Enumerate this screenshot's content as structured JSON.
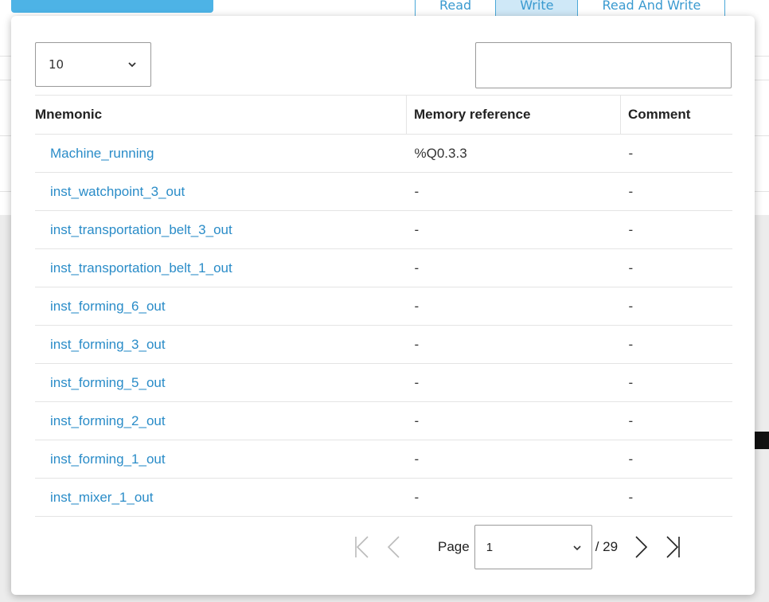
{
  "background": {
    "tabs": [
      {
        "label": "Read",
        "active": false
      },
      {
        "label": "Write",
        "active": true
      },
      {
        "label": "Read And Write",
        "active": false
      }
    ]
  },
  "modal": {
    "page_size": "10",
    "search": {
      "value": "",
      "placeholder": ""
    },
    "table": {
      "headers": [
        "Mnemonic",
        "Memory reference",
        "Comment"
      ],
      "rows": [
        {
          "mnemonic": "Machine_running",
          "memory": "%Q0.3.3",
          "comment": "-"
        },
        {
          "mnemonic": "inst_watchpoint_3_out",
          "memory": "-",
          "comment": "-"
        },
        {
          "mnemonic": "inst_transportation_belt_3_out",
          "memory": "-",
          "comment": "-"
        },
        {
          "mnemonic": "inst_transportation_belt_1_out",
          "memory": "-",
          "comment": "-"
        },
        {
          "mnemonic": "inst_forming_6_out",
          "memory": "-",
          "comment": "-"
        },
        {
          "mnemonic": "inst_forming_3_out",
          "memory": "-",
          "comment": "-"
        },
        {
          "mnemonic": "inst_forming_5_out",
          "memory": "-",
          "comment": "-"
        },
        {
          "mnemonic": "inst_forming_2_out",
          "memory": "-",
          "comment": "-"
        },
        {
          "mnemonic": "inst_forming_1_out",
          "memory": "-",
          "comment": "-"
        },
        {
          "mnemonic": "inst_mixer_1_out",
          "memory": "-",
          "comment": "-"
        }
      ]
    },
    "pager": {
      "page_label": "Page",
      "current_page": "1",
      "total": "/ 29"
    }
  },
  "colors": {
    "link": "#2a8cc8",
    "accent": "#4db3e6",
    "tab_active_bg": "#cfe8f7"
  }
}
